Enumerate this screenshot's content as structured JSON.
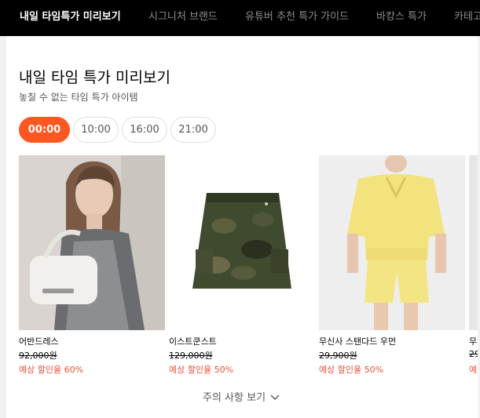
{
  "nav": {
    "tabs": [
      {
        "label": "내일 타임특가 미리보기",
        "active": true
      },
      {
        "label": "시그니처 브랜드",
        "active": false
      },
      {
        "label": "유튜버 추천 특가 가이드",
        "active": false
      },
      {
        "label": "바캉스 특가",
        "active": false
      },
      {
        "label": "카테고리",
        "active": false
      }
    ]
  },
  "section": {
    "title": "내일 타임 특가 미리보기",
    "subtitle": "놓칠 수 없는 타임 특가 아이템"
  },
  "time_slots": [
    {
      "label": "00:00",
      "active": true
    },
    {
      "label": "10:00",
      "active": false
    },
    {
      "label": "16:00",
      "active": false
    },
    {
      "label": "21:00",
      "active": false
    }
  ],
  "products": [
    {
      "brand": "어반드레스",
      "price": "92,000원",
      "discount": "예상 할인율 60%"
    },
    {
      "brand": "이스트쿤스트",
      "price": "129,000원",
      "discount": "예상 할인율 50%"
    },
    {
      "brand": "무신사 스탠다드 우먼",
      "price": "29,900원",
      "discount": "예상 할인율 50%"
    },
    {
      "brand": "무",
      "price": "29",
      "discount": "예"
    }
  ],
  "notice": {
    "label": "주의 사항 보기",
    "icon": "chevron-down-icon"
  },
  "colors": {
    "accent": "#ff5722",
    "discount": "#e8513a",
    "nav_bg": "#000000"
  }
}
